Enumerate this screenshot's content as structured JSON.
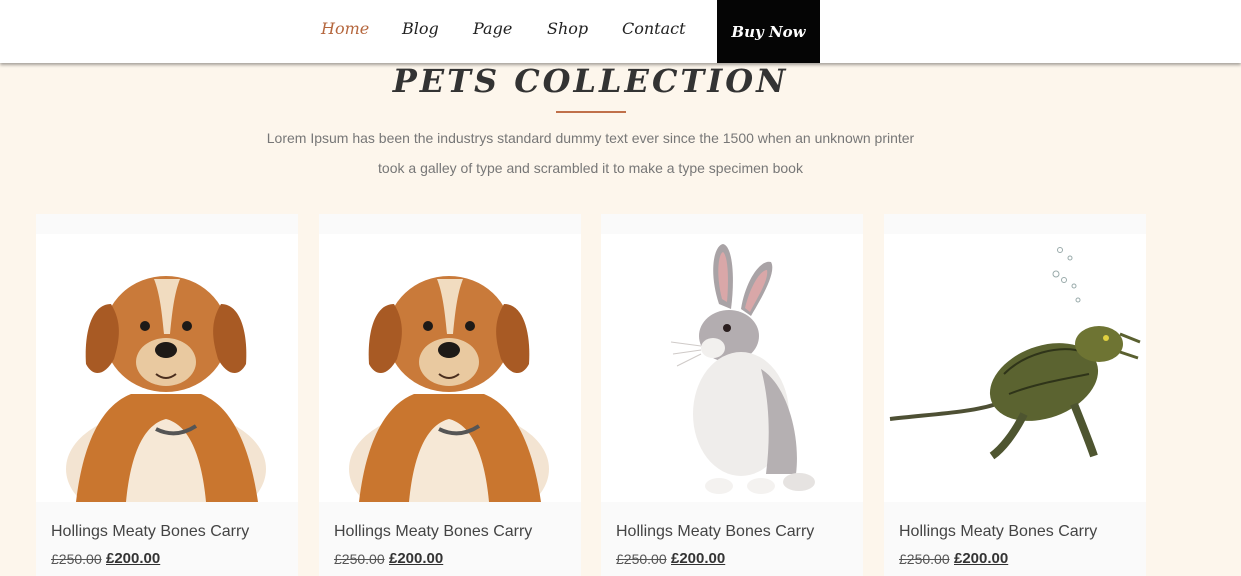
{
  "nav": {
    "items": [
      {
        "label": "Home",
        "active": true
      },
      {
        "label": "Blog",
        "active": false
      },
      {
        "label": "Page",
        "active": false
      },
      {
        "label": "Shop",
        "active": false
      },
      {
        "label": "Contact",
        "active": false
      }
    ],
    "buy_label": "Buy Now"
  },
  "section": {
    "title": "PETS COLLECTION",
    "desc_line1": "Lorem Ipsum has been the industrys standard dummy text ever since the 1500 when an unknown printer",
    "desc_line2": "took a galley of type and scrambled it to make a type specimen book"
  },
  "products": [
    {
      "name": "Hollings Meaty Bones Carry",
      "old_price": "£250.00",
      "price": "£200.00",
      "image": "dog-image"
    },
    {
      "name": "Hollings Meaty Bones Carry",
      "old_price": "£250.00",
      "price": "£200.00",
      "image": "dog-image"
    },
    {
      "name": "Hollings Meaty Bones Carry",
      "old_price": "£250.00",
      "price": "£200.00",
      "image": "rabbit-image"
    },
    {
      "name": "Hollings Meaty Bones Carry",
      "old_price": "£250.00",
      "price": "£200.00",
      "image": "turtle-image"
    }
  ],
  "colors": {
    "page_background": "#fdf6ec",
    "accent": "#b5673e",
    "button_background": "#050505"
  }
}
